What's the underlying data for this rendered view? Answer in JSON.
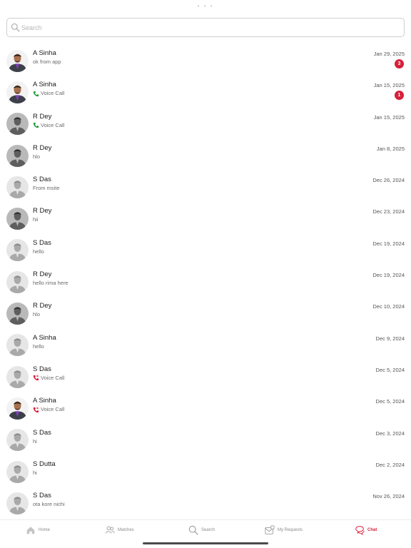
{
  "top_indicator": "• • •",
  "search": {
    "placeholder": "Search",
    "icon": "search-icon"
  },
  "chats": [
    {
      "name": "A Sinha",
      "preview": "ok from app",
      "preview_type": "text",
      "date": "Jan 29, 2025",
      "unread": "3",
      "avatar": "photo-man-purple"
    },
    {
      "name": "A Sinha",
      "preview": "Voice Call",
      "preview_type": "call-answered",
      "date": "Jan 15, 2025",
      "unread": "1",
      "avatar": "photo-man-purple"
    },
    {
      "name": "R Dey",
      "preview": "Voice Call",
      "preview_type": "call-answered",
      "date": "Jan 15, 2025",
      "unread": "",
      "avatar": "placeholder-dark"
    },
    {
      "name": "R Dey",
      "preview": "hlo",
      "preview_type": "text",
      "date": "Jan 8, 2025",
      "unread": "",
      "avatar": "placeholder-dark"
    },
    {
      "name": "S Das",
      "preview": "From msite",
      "preview_type": "text",
      "date": "Dec 26, 2024",
      "unread": "",
      "avatar": "placeholder-light"
    },
    {
      "name": "R Dey",
      "preview": "hii",
      "preview_type": "text",
      "date": "Dec 23, 2024",
      "unread": "",
      "avatar": "placeholder-dark"
    },
    {
      "name": "S Das",
      "preview": "hello",
      "preview_type": "text",
      "date": "Dec 19, 2024",
      "unread": "",
      "avatar": "placeholder-light"
    },
    {
      "name": "R Dey",
      "preview": "hello rima here",
      "preview_type": "text",
      "date": "Dec 19, 2024",
      "unread": "",
      "avatar": "placeholder-light"
    },
    {
      "name": "R Dey",
      "preview": "hlo",
      "preview_type": "text",
      "date": "Dec 10, 2024",
      "unread": "",
      "avatar": "placeholder-dark"
    },
    {
      "name": "A Sinha",
      "preview": "hello",
      "preview_type": "text",
      "date": "Dec 9, 2024",
      "unread": "",
      "avatar": "placeholder-light"
    },
    {
      "name": "S Das",
      "preview": "Voice Call",
      "preview_type": "call-missed",
      "date": "Dec 5, 2024",
      "unread": "",
      "avatar": "placeholder-light"
    },
    {
      "name": "A Sinha",
      "preview": "Voice Call",
      "preview_type": "call-missed",
      "date": "Dec 5, 2024",
      "unread": "",
      "avatar": "photo-man-purple"
    },
    {
      "name": "S Das",
      "preview": "hi",
      "preview_type": "text",
      "date": "Dec 3, 2024",
      "unread": "",
      "avatar": "placeholder-light"
    },
    {
      "name": "S Dutta",
      "preview": "hi",
      "preview_type": "text",
      "date": "Dec 2, 2024",
      "unread": "",
      "avatar": "placeholder-light"
    },
    {
      "name": "S Das",
      "preview": "ota kore nichi",
      "preview_type": "text",
      "date": "Nov 26, 2024",
      "unread": "",
      "avatar": "placeholder-light"
    }
  ],
  "tabbar": {
    "home": "Home",
    "matches": "Matches",
    "search": "Search",
    "requests": "My Requests",
    "chat": "Chat"
  },
  "colors": {
    "accent": "#d61f3a",
    "call_answered": "#1e9e3a",
    "call_missed": "#d61f3a"
  }
}
